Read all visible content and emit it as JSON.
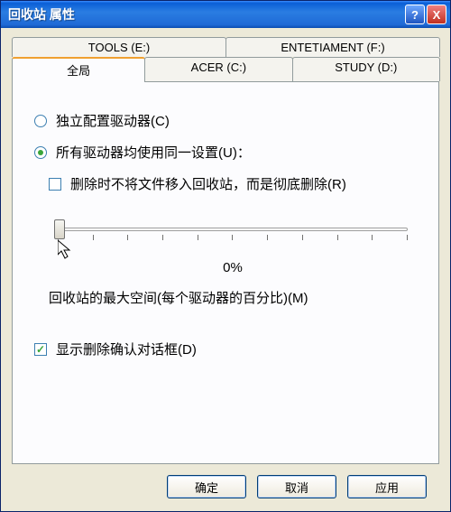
{
  "window": {
    "title": "回收站 属性",
    "help_glyph": "?",
    "close_glyph": "X"
  },
  "tabs": {
    "row1": [
      {
        "label": "TOOLS (E:)"
      },
      {
        "label": "ENTETIAMENT (F:)"
      }
    ],
    "row2": [
      {
        "label": "全局",
        "active": true
      },
      {
        "label": "ACER (C:)"
      },
      {
        "label": "STUDY (D:)"
      }
    ]
  },
  "options": {
    "independent": {
      "label": "独立配置驱动器(C)",
      "checked": false
    },
    "use_same": {
      "label": "所有驱动器均使用同一设置(U)：",
      "checked": true
    },
    "permanent_delete": {
      "label": "删除时不将文件移入回收站，而是彻底删除(R)",
      "checked": false
    },
    "confirm_dialog": {
      "label": "显示删除确认对话框(D)",
      "checked": true
    }
  },
  "slider": {
    "value_pct": "0%",
    "caption": "回收站的最大空间(每个驱动器的百分比)(M)"
  },
  "buttons": {
    "ok": "确定",
    "cancel": "取消",
    "apply": "应用"
  }
}
